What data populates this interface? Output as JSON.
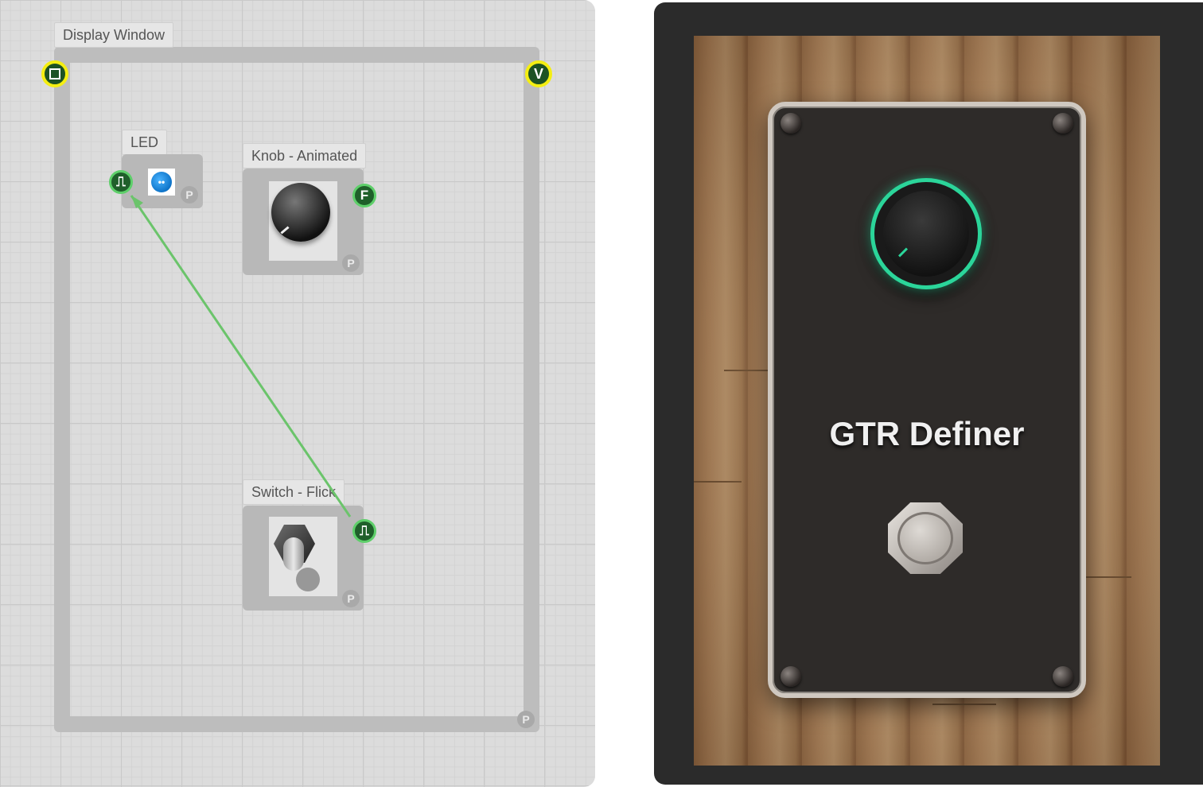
{
  "editor": {
    "display_window": {
      "label": "Display Window",
      "left_port_icon": "square-stop-icon",
      "right_port": "V",
      "param_badge": "P"
    },
    "nodes": {
      "led": {
        "label": "LED",
        "input_port_icon": "pulse-wave-icon",
        "param_badge": "P"
      },
      "knob": {
        "label": "Knob - Animated",
        "output_port": "F",
        "param_badge": "P"
      },
      "switch": {
        "label": "Switch - Flick",
        "output_port_icon": "pulse-wave-icon",
        "param_badge": "P"
      }
    },
    "connection": {
      "from": "Switch - Flick",
      "to": "LED",
      "color": "#6bc46b"
    }
  },
  "preview": {
    "title": "GTR Definer",
    "accent_color": "#2bd59a"
  }
}
